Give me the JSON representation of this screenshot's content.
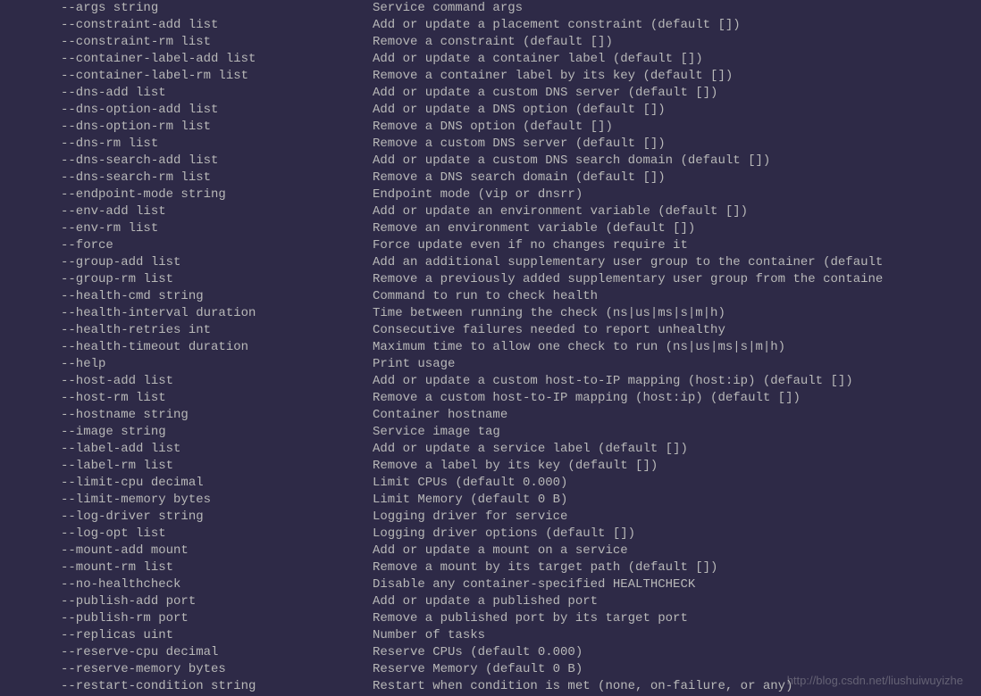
{
  "options": [
    {
      "flag": "--args string",
      "desc": "Service command args"
    },
    {
      "flag": "--constraint-add list",
      "desc": "Add or update a placement constraint (default [])"
    },
    {
      "flag": "--constraint-rm list",
      "desc": "Remove a constraint (default [])"
    },
    {
      "flag": "--container-label-add list",
      "desc": "Add or update a container label (default [])"
    },
    {
      "flag": "--container-label-rm list",
      "desc": "Remove a container label by its key (default [])"
    },
    {
      "flag": "--dns-add list",
      "desc": "Add or update a custom DNS server (default [])"
    },
    {
      "flag": "--dns-option-add list",
      "desc": "Add or update a DNS option (default [])"
    },
    {
      "flag": "--dns-option-rm list",
      "desc": "Remove a DNS option (default [])"
    },
    {
      "flag": "--dns-rm list",
      "desc": "Remove a custom DNS server (default [])"
    },
    {
      "flag": "--dns-search-add list",
      "desc": "Add or update a custom DNS search domain (default [])"
    },
    {
      "flag": "--dns-search-rm list",
      "desc": "Remove a DNS search domain (default [])"
    },
    {
      "flag": "--endpoint-mode string",
      "desc": "Endpoint mode (vip or dnsrr)"
    },
    {
      "flag": "--env-add list",
      "desc": "Add or update an environment variable (default [])"
    },
    {
      "flag": "--env-rm list",
      "desc": "Remove an environment variable (default [])"
    },
    {
      "flag": "--force",
      "desc": "Force update even if no changes require it"
    },
    {
      "flag": "--group-add list",
      "desc": "Add an additional supplementary user group to the container (default"
    },
    {
      "flag": "--group-rm list",
      "desc": "Remove a previously added supplementary user group from the containe"
    },
    {
      "flag": "--health-cmd string",
      "desc": "Command to run to check health"
    },
    {
      "flag": "--health-interval duration",
      "desc": "Time between running the check (ns|us|ms|s|m|h)"
    },
    {
      "flag": "--health-retries int",
      "desc": "Consecutive failures needed to report unhealthy"
    },
    {
      "flag": "--health-timeout duration",
      "desc": "Maximum time to allow one check to run (ns|us|ms|s|m|h)"
    },
    {
      "flag": "--help",
      "desc": "Print usage"
    },
    {
      "flag": "--host-add list",
      "desc": "Add or update a custom host-to-IP mapping (host:ip) (default [])"
    },
    {
      "flag": "--host-rm list",
      "desc": "Remove a custom host-to-IP mapping (host:ip) (default [])"
    },
    {
      "flag": "--hostname string",
      "desc": "Container hostname"
    },
    {
      "flag": "--image string",
      "desc": "Service image tag"
    },
    {
      "flag": "--label-add list",
      "desc": "Add or update a service label (default [])"
    },
    {
      "flag": "--label-rm list",
      "desc": "Remove a label by its key (default [])"
    },
    {
      "flag": "--limit-cpu decimal",
      "desc": "Limit CPUs (default 0.000)"
    },
    {
      "flag": "--limit-memory bytes",
      "desc": "Limit Memory (default 0 B)"
    },
    {
      "flag": "--log-driver string",
      "desc": "Logging driver for service"
    },
    {
      "flag": "--log-opt list",
      "desc": "Logging driver options (default [])"
    },
    {
      "flag": "--mount-add mount",
      "desc": "Add or update a mount on a service"
    },
    {
      "flag": "--mount-rm list",
      "desc": "Remove a mount by its target path (default [])"
    },
    {
      "flag": "--no-healthcheck",
      "desc": "Disable any container-specified HEALTHCHECK"
    },
    {
      "flag": "--publish-add port",
      "desc": "Add or update a published port"
    },
    {
      "flag": "--publish-rm port",
      "desc": "Remove a published port by its target port"
    },
    {
      "flag": "--replicas uint",
      "desc": "Number of tasks"
    },
    {
      "flag": "--reserve-cpu decimal",
      "desc": "Reserve CPUs (default 0.000)"
    },
    {
      "flag": "--reserve-memory bytes",
      "desc": "Reserve Memory (default 0 B)"
    },
    {
      "flag": "--restart-condition string",
      "desc": "Restart when condition is met (none, on-failure, or any)"
    }
  ],
  "watermark": "http://blog.csdn.net/liushuiwuyizhe"
}
